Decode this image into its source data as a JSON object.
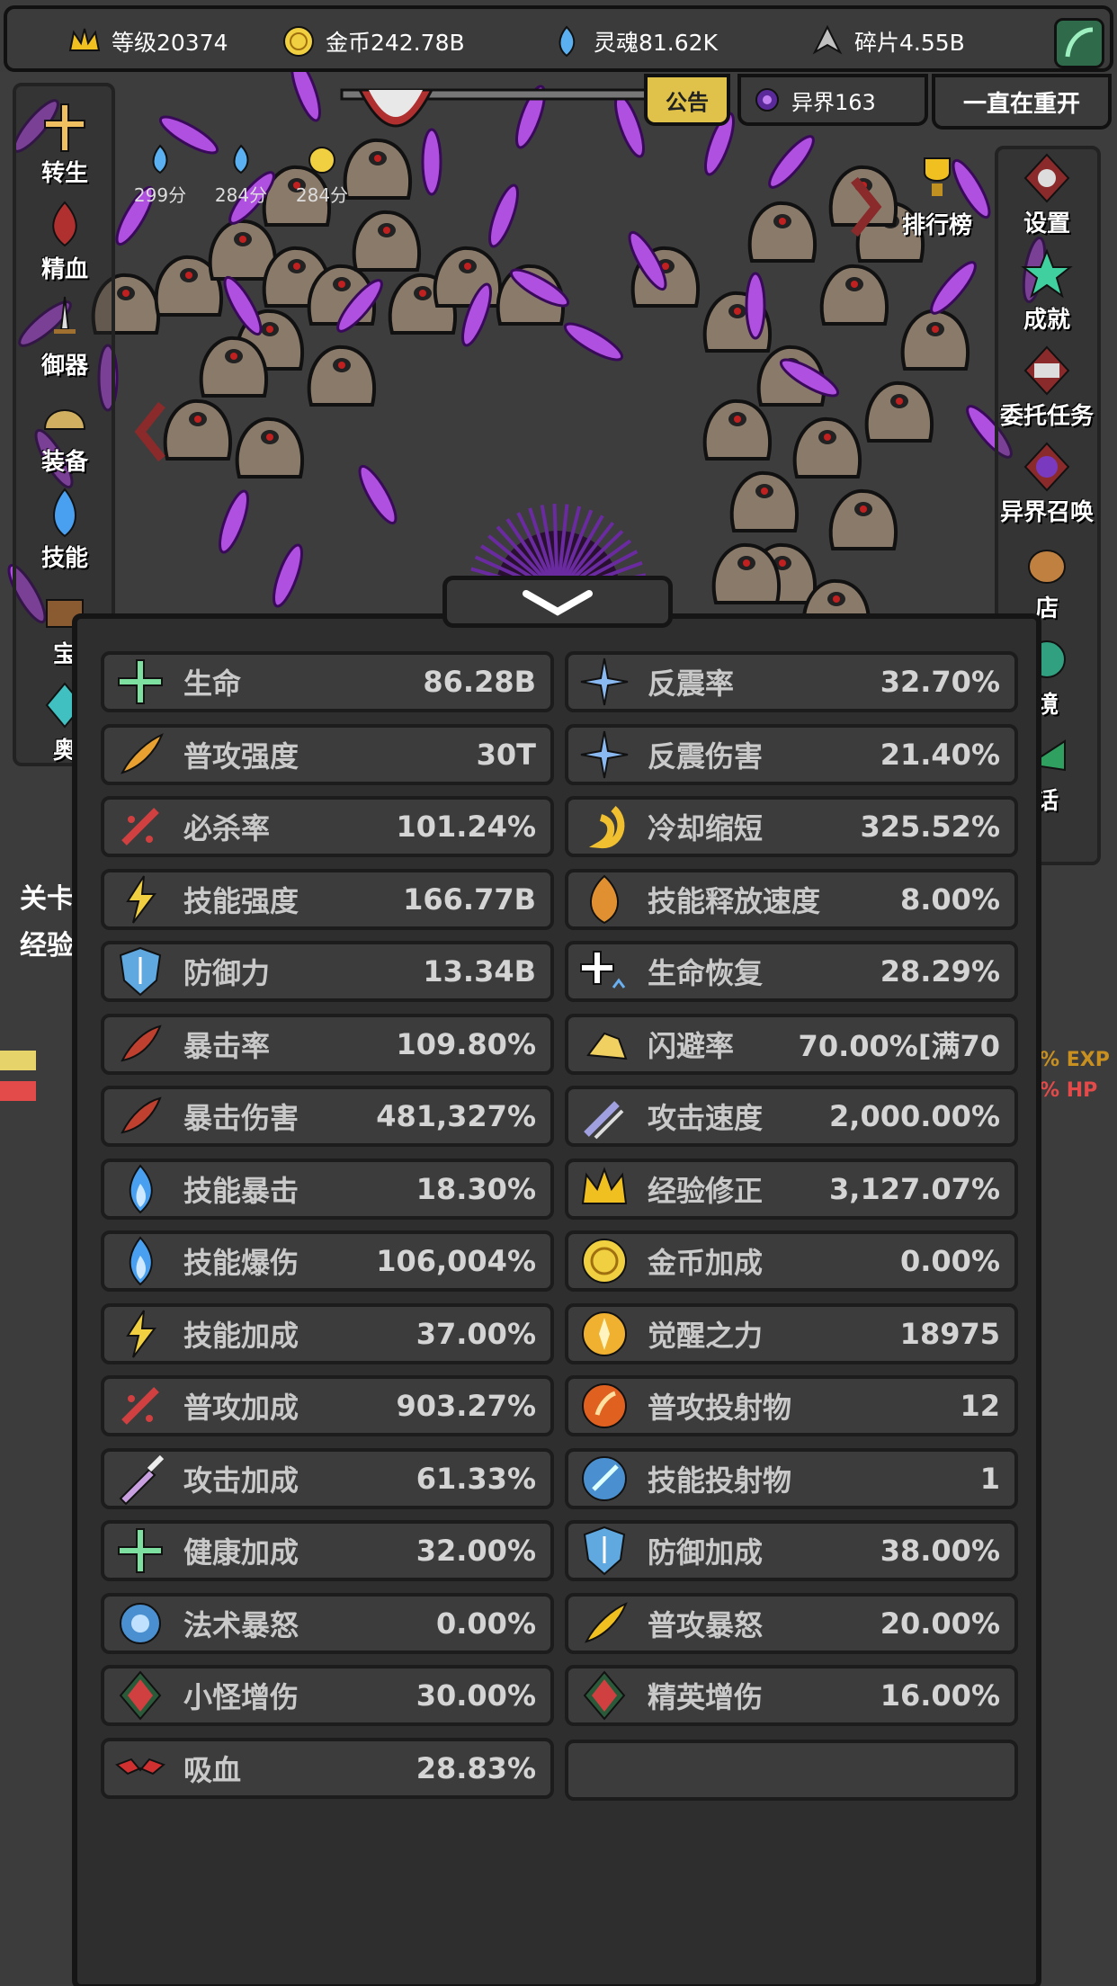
{
  "topbar": {
    "level": "等级20374",
    "gold": "金币242.78B",
    "soul": "灵魂81.62K",
    "shard": "碎片4.55B"
  },
  "tabs": {
    "notice": "公告",
    "realm": "异界163",
    "restart": "一直在重开"
  },
  "scores": [
    "299分",
    "284分",
    "284分"
  ],
  "left_menu": [
    "转生",
    "精血",
    "御器",
    "装备",
    "技能",
    "宝",
    "奥"
  ],
  "right_menu": [
    "排行榜",
    "设置",
    "成就",
    "委托任务",
    "异界召唤",
    "店",
    "境",
    "话"
  ],
  "background": {
    "stage_label": "关卡",
    "exp_label": "经验",
    "exp_suffix": "% EXP",
    "hp_suffix": "% HP"
  },
  "stats_left": [
    {
      "label": "生命",
      "value": "86.28B",
      "icon": "health-cross-icon",
      "color": "#7ee0a0"
    },
    {
      "label": "普攻强度",
      "value": "30T",
      "icon": "attack-feather-icon",
      "color": "#e8a030"
    },
    {
      "label": "必杀率",
      "value": "101.24%",
      "icon": "fatal-slash-icon",
      "color": "#d04040"
    },
    {
      "label": "技能强度",
      "value": "166.77B",
      "icon": "lightning-icon",
      "color": "#f0d040"
    },
    {
      "label": "防御力",
      "value": "13.34B",
      "icon": "shield-icon",
      "color": "#60a8e0"
    },
    {
      "label": "暴击率",
      "value": "109.80%",
      "icon": "crit-claw-icon",
      "color": "#c04030"
    },
    {
      "label": "暴击伤害",
      "value": "481,327%",
      "icon": "crit-claw-icon",
      "color": "#c04030"
    },
    {
      "label": "技能暴击",
      "value": "18.30%",
      "icon": "blue-flame-icon",
      "color": "#4aa0f0"
    },
    {
      "label": "技能爆伤",
      "value": "106,004%",
      "icon": "blue-flame-icon",
      "color": "#4aa0f0"
    },
    {
      "label": "技能加成",
      "value": "37.00%",
      "icon": "lightning-icon",
      "color": "#f0d040"
    },
    {
      "label": "普攻加成",
      "value": "903.27%",
      "icon": "fatal-slash-icon",
      "color": "#d04040"
    },
    {
      "label": "攻击加成",
      "value": "61.33%",
      "icon": "sword-icon",
      "color": "#c8a0e0"
    },
    {
      "label": "健康加成",
      "value": "32.00%",
      "icon": "health-cross-icon",
      "color": "#7ee0a0"
    },
    {
      "label": "法术暴怒",
      "value": "0.00%",
      "icon": "magic-orb-icon",
      "color": "#4a90d0"
    },
    {
      "label": "小怪增伤",
      "value": "30.00%",
      "icon": "diamond-eye-icon",
      "color": "#d04040"
    },
    {
      "label": "吸血",
      "value": "28.83%",
      "icon": "bat-icon",
      "color": "#d03030"
    }
  ],
  "stats_right": [
    {
      "label": "反震率",
      "value": "32.70%",
      "icon": "ice-shard-icon",
      "color": "#8ab8f0"
    },
    {
      "label": "反震伤害",
      "value": "21.40%",
      "icon": "ice-shard-icon",
      "color": "#8ab8f0"
    },
    {
      "label": "冷却缩短",
      "value": "325.52%",
      "icon": "swirl-icon",
      "color": "#f0c030"
    },
    {
      "label": "技能释放速度",
      "value": "8.00%",
      "icon": "fire-orb-icon",
      "color": "#e09030"
    },
    {
      "label": "生命恢复",
      "value": "28.29%",
      "icon": "heal-regen-icon",
      "color": "#ffffff"
    },
    {
      "label": "闪避率",
      "value": "70.00%[满70",
      "icon": "winged-boot-icon",
      "color": "#f0d060"
    },
    {
      "label": "攻击速度",
      "value": "2,000.00%",
      "icon": "speed-sword-icon",
      "color": "#a0a0e0"
    },
    {
      "label": "经验修正",
      "value": "3,127.07%",
      "icon": "crown-icon",
      "color": "#f0c020"
    },
    {
      "label": "金币加成",
      "value": "0.00%",
      "icon": "gold-coin-icon",
      "color": "#f0d040"
    },
    {
      "label": "觉醒之力",
      "value": "18975",
      "icon": "sun-emblem-icon",
      "color": "#f0b030"
    },
    {
      "label": "普攻投射物",
      "value": "12",
      "icon": "fire-projectile-icon",
      "color": "#e06020"
    },
    {
      "label": "技能投射物",
      "value": "1",
      "icon": "blue-projectile-icon",
      "color": "#4a90d0"
    },
    {
      "label": "防御加成",
      "value": "38.00%",
      "icon": "shield-icon",
      "color": "#60a8e0"
    },
    {
      "label": "普攻暴怒",
      "value": "20.00%",
      "icon": "gold-feather-icon",
      "color": "#f0c020"
    },
    {
      "label": "精英增伤",
      "value": "16.00%",
      "icon": "diamond-eye-icon",
      "color": "#d04040"
    }
  ]
}
